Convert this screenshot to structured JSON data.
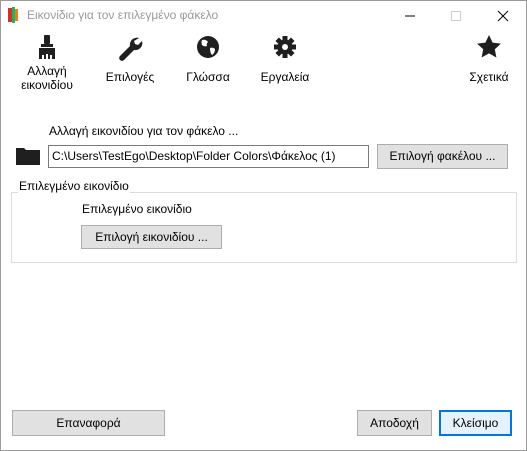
{
  "window": {
    "title": "Εικονίδιο  για τον επιλεγμένο φάκελο"
  },
  "toolbar": {
    "change_icon_label": "Αλλαγή εικονιδίου",
    "options_label": "Επιλογές",
    "language_label": "Γλώσσα",
    "tools_label": "Εργαλεία",
    "about_label": "Σχετικά"
  },
  "folder_section": {
    "label": "Αλλαγή εικονιδίου για τον φάκελο ...",
    "path_value": "C:\\Users\\TestEgo\\Desktop\\Folder Colors\\Φάκελος (1)",
    "choose_folder_button": "Επιλογή φακέλου ..."
  },
  "icon_group": {
    "legend": "Επιλεγμένο εικονίδιο",
    "text": "Επιλεγμένο εικονίδιο",
    "choose_icon_button": "Επιλογή εικονιδίου ..."
  },
  "footer": {
    "reset_button": "Επαναφορά",
    "apply_button": "Αποδοχή",
    "close_button": "Κλείσιμο"
  },
  "colors": {
    "accent": "#0078d7",
    "icon": "#1f1f1f",
    "button_face": "#e1e1e1"
  }
}
